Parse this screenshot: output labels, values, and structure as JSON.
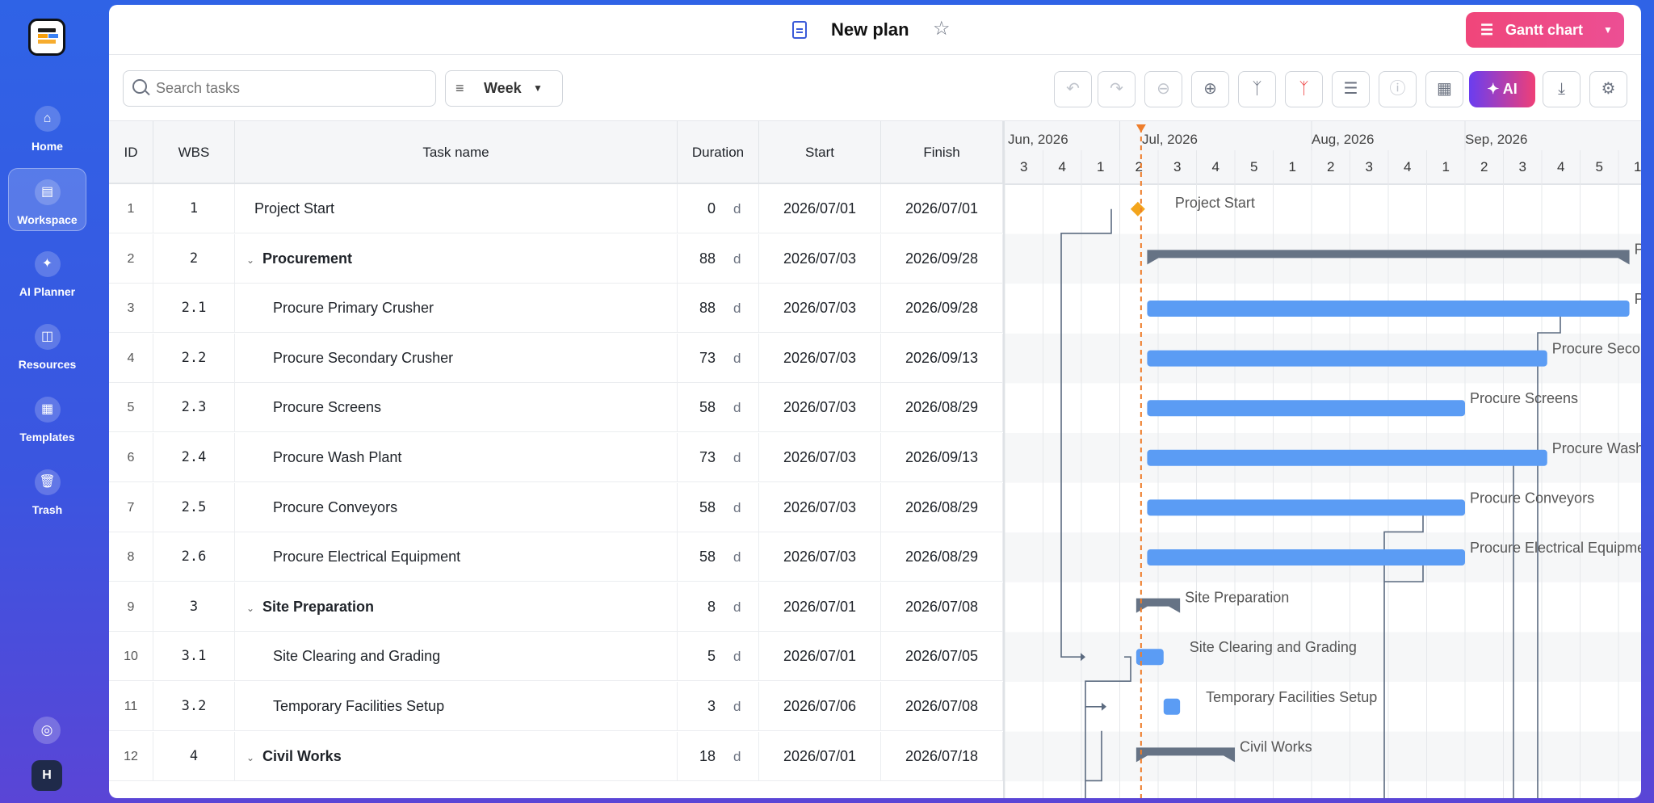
{
  "sidebar": {
    "items": [
      {
        "label": "Home",
        "icon": "home-icon"
      },
      {
        "label": "Workspace",
        "icon": "workspace-icon",
        "active": true
      },
      {
        "label": "AI Planner",
        "icon": "ai-sparkle-icon"
      },
      {
        "label": "Resources",
        "icon": "database-icon"
      },
      {
        "label": "Templates",
        "icon": "templates-icon"
      },
      {
        "label": "Trash",
        "icon": "trash-icon"
      }
    ],
    "avatar": "H"
  },
  "header": {
    "title": "New plan",
    "view_button": "Gantt chart"
  },
  "toolbar": {
    "search_placeholder": "Search tasks",
    "scale": "Week",
    "ai_label": "AI",
    "tools": [
      "undo-icon",
      "redo-icon",
      "zoom-out-icon",
      "zoom-in-icon",
      "branch-icon",
      "critical-path-icon",
      "checklist-icon",
      "info-icon",
      "calendar-icon",
      "download-icon",
      "settings-icon"
    ]
  },
  "table": {
    "columns": [
      "ID",
      "WBS",
      "Task name",
      "Duration",
      "Start",
      "Finish"
    ],
    "duration_unit": "d",
    "rows": [
      {
        "id": "1",
        "wbs": "1",
        "name": "Project Start",
        "duration": "0",
        "start": "2026/07/01",
        "finish": "2026/07/01",
        "summary": false,
        "indent": 0
      },
      {
        "id": "2",
        "wbs": "2",
        "name": "Procurement",
        "duration": "88",
        "start": "2026/07/03",
        "finish": "2026/09/28",
        "summary": true,
        "indent": 0
      },
      {
        "id": "3",
        "wbs": "2.1",
        "name": "Procure Primary Crusher",
        "duration": "88",
        "start": "2026/07/03",
        "finish": "2026/09/28",
        "summary": false,
        "indent": 1
      },
      {
        "id": "4",
        "wbs": "2.2",
        "name": "Procure Secondary Crusher",
        "duration": "73",
        "start": "2026/07/03",
        "finish": "2026/09/13",
        "summary": false,
        "indent": 1
      },
      {
        "id": "5",
        "wbs": "2.3",
        "name": "Procure Screens",
        "duration": "58",
        "start": "2026/07/03",
        "finish": "2026/08/29",
        "summary": false,
        "indent": 1
      },
      {
        "id": "6",
        "wbs": "2.4",
        "name": "Procure Wash Plant",
        "duration": "73",
        "start": "2026/07/03",
        "finish": "2026/09/13",
        "summary": false,
        "indent": 1
      },
      {
        "id": "7",
        "wbs": "2.5",
        "name": "Procure Conveyors",
        "duration": "58",
        "start": "2026/07/03",
        "finish": "2026/08/29",
        "summary": false,
        "indent": 1
      },
      {
        "id": "8",
        "wbs": "2.6",
        "name": "Procure Electrical Equipment",
        "duration": "58",
        "start": "2026/07/03",
        "finish": "2026/08/29",
        "summary": false,
        "indent": 1
      },
      {
        "id": "9",
        "wbs": "3",
        "name": "Site Preparation",
        "duration": "8",
        "start": "2026/07/01",
        "finish": "2026/07/08",
        "summary": true,
        "indent": 0
      },
      {
        "id": "10",
        "wbs": "3.1",
        "name": "Site Clearing and Grading",
        "duration": "5",
        "start": "2026/07/01",
        "finish": "2026/07/05",
        "summary": false,
        "indent": 1
      },
      {
        "id": "11",
        "wbs": "3.2",
        "name": "Temporary Facilities Setup",
        "duration": "3",
        "start": "2026/07/06",
        "finish": "2026/07/08",
        "summary": false,
        "indent": 1
      },
      {
        "id": "12",
        "wbs": "4",
        "name": "Civil Works",
        "duration": "18",
        "start": "2026/07/01",
        "finish": "2026/07/18",
        "summary": true,
        "indent": 0
      }
    ]
  },
  "timeline": {
    "months": [
      "Jun, 2026",
      "Jul, 2026",
      "Aug, 2026",
      "Sep, 2026"
    ],
    "weeks": [
      "3",
      "4",
      "1",
      "2",
      "3",
      "4",
      "5",
      "1",
      "2",
      "3",
      "4",
      "1",
      "2",
      "3",
      "4",
      "5",
      "1"
    ],
    "today": "2026/07/01",
    "bars": [
      {
        "row": 1,
        "type": "milestone",
        "start": "2026/07/01",
        "finish": "2026/07/01",
        "label": "Project Start"
      },
      {
        "row": 2,
        "type": "summary",
        "start": "2026/07/03",
        "finish": "2026/09/28",
        "label": "Procurement"
      },
      {
        "row": 3,
        "type": "task",
        "start": "2026/07/03",
        "finish": "2026/09/28",
        "label": "Procure Primary Crusher"
      },
      {
        "row": 4,
        "type": "task",
        "start": "2026/07/03",
        "finish": "2026/09/13",
        "label": "Procure Secondary Crusher"
      },
      {
        "row": 5,
        "type": "task",
        "start": "2026/07/03",
        "finish": "2026/08/29",
        "label": "Procure Screens"
      },
      {
        "row": 6,
        "type": "task",
        "start": "2026/07/03",
        "finish": "2026/09/13",
        "label": "Procure Wash Plant"
      },
      {
        "row": 7,
        "type": "task",
        "start": "2026/07/03",
        "finish": "2026/08/29",
        "label": "Procure Conveyors"
      },
      {
        "row": 8,
        "type": "task",
        "start": "2026/07/03",
        "finish": "2026/08/29",
        "label": "Procure Electrical Equipment"
      },
      {
        "row": 9,
        "type": "summary",
        "start": "2026/07/01",
        "finish": "2026/07/08",
        "label": "Site Preparation"
      },
      {
        "row": 10,
        "type": "task",
        "start": "2026/07/01",
        "finish": "2026/07/05",
        "label": "Site Clearing and Grading"
      },
      {
        "row": 11,
        "type": "task",
        "start": "2026/07/06",
        "finish": "2026/07/08",
        "label": "Temporary Facilities Setup"
      },
      {
        "row": 12,
        "type": "summary",
        "start": "2026/07/01",
        "finish": "2026/07/18",
        "label": "Civil Works"
      }
    ],
    "colors": {
      "task": "#5b9cf4",
      "summary": "#667385",
      "milestone": "#f3a51c",
      "today": "#ee7d2b",
      "link": "#5c6b80"
    }
  }
}
